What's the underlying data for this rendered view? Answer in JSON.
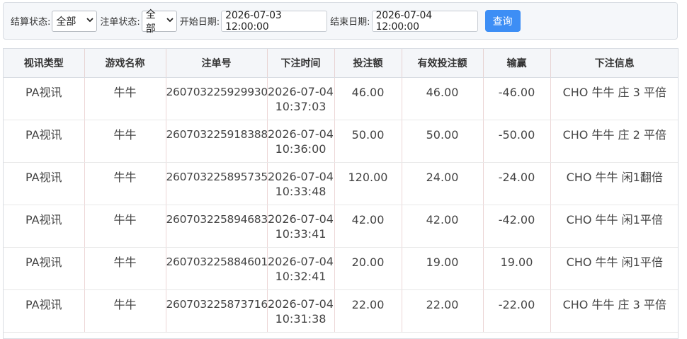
{
  "filters": {
    "settle_label": "结算状态:",
    "settle_value": "全部",
    "order_label": "注单状态:",
    "order_value": "全部",
    "start_label": "开始日期:",
    "start_value": "2026-07-03 12:00:00",
    "end_label": "结束日期:",
    "end_value": "2026-07-04 12:00:00",
    "query_label": "查询"
  },
  "table": {
    "headers": [
      "视讯类型",
      "游戏名称",
      "注单号",
      "下注时间",
      "投注额",
      "有效投注额",
      "输赢",
      "下注信息"
    ],
    "rows": [
      {
        "type": "PA视讯",
        "game": "牛牛",
        "id": "260703225929930",
        "date": "2026-07-04",
        "time": "10:37:03",
        "bet": "46.00",
        "valid": "46.00",
        "win": "-46.00",
        "info": "CHO 牛牛 庄 3 平倍"
      },
      {
        "type": "PA视讯",
        "game": "牛牛",
        "id": "260703225918388",
        "date": "2026-07-04",
        "time": "10:36:00",
        "bet": "50.00",
        "valid": "50.00",
        "win": "-50.00",
        "info": "CHO 牛牛 庄 2 平倍"
      },
      {
        "type": "PA视讯",
        "game": "牛牛",
        "id": "260703225895735",
        "date": "2026-07-04",
        "time": "10:33:48",
        "bet": "120.00",
        "valid": "24.00",
        "win": "-24.00",
        "info": "CHO 牛牛 闲1翻倍"
      },
      {
        "type": "PA视讯",
        "game": "牛牛",
        "id": "260703225894683",
        "date": "2026-07-04",
        "time": "10:33:41",
        "bet": "42.00",
        "valid": "42.00",
        "win": "-42.00",
        "info": "CHO 牛牛 闲1平倍"
      },
      {
        "type": "PA视讯",
        "game": "牛牛",
        "id": "260703225884601",
        "date": "2026-07-04",
        "time": "10:32:41",
        "bet": "20.00",
        "valid": "19.00",
        "win": "19.00",
        "info": "CHO 牛牛 闲1平倍"
      },
      {
        "type": "PA视讯",
        "game": "牛牛",
        "id": "260703225873716",
        "date": "2026-07-04",
        "time": "10:31:38",
        "bet": "22.00",
        "valid": "22.00",
        "win": "-22.00",
        "info": "CHO 牛牛 庄 3 平倍"
      }
    ]
  },
  "colors": {
    "accent": "#3d8ef5",
    "header_bg": "#f4f6f9"
  }
}
